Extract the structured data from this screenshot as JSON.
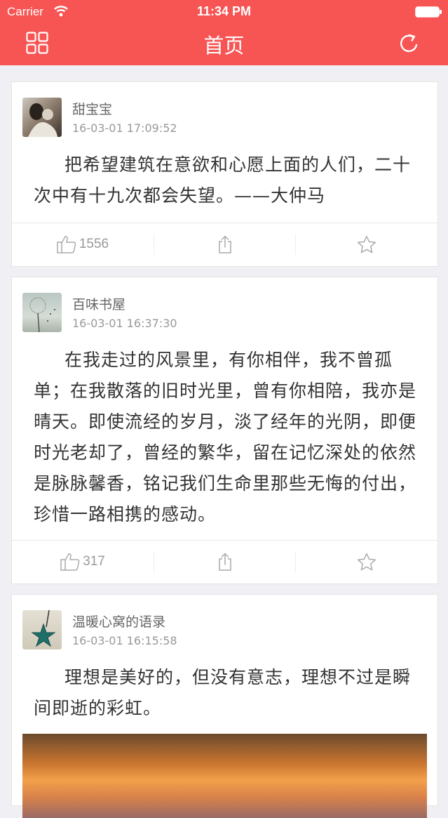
{
  "status_bar": {
    "carrier": "Carrier",
    "time": "11:34 PM"
  },
  "nav": {
    "title": "首页",
    "left_icon": "grid-icon",
    "right_icon": "refresh-icon"
  },
  "colors": {
    "brand": "#f75454",
    "background": "#efeff4"
  },
  "posts": [
    {
      "author": "甜宝宝",
      "time": "16-03-01 17:09:52",
      "text": "把希望建筑在意欲和心愿上面的人们，二十次中有十九次都会失望。——大仲马",
      "likes": "1556"
    },
    {
      "author": "百味书屋",
      "time": "16-03-01 16:37:30",
      "text": "在我走过的风景里，有你相伴，我不曾孤单；在我散落的旧时光里，曾有你相陪，我亦是晴天。即使流经的岁月，淡了经年的光阴，即便时光老却了，曾经的繁华，留在记忆深处的依然是脉脉馨香，铭记我们生命里那些无悔的付出，珍惜一路相携的感动。",
      "likes": "317"
    },
    {
      "author": "温暖心窝的语录",
      "time": "16-03-01 16:15:58",
      "text": "理想是美好的，但没有意志，理想不过是瞬间即逝的彩虹。"
    }
  ]
}
